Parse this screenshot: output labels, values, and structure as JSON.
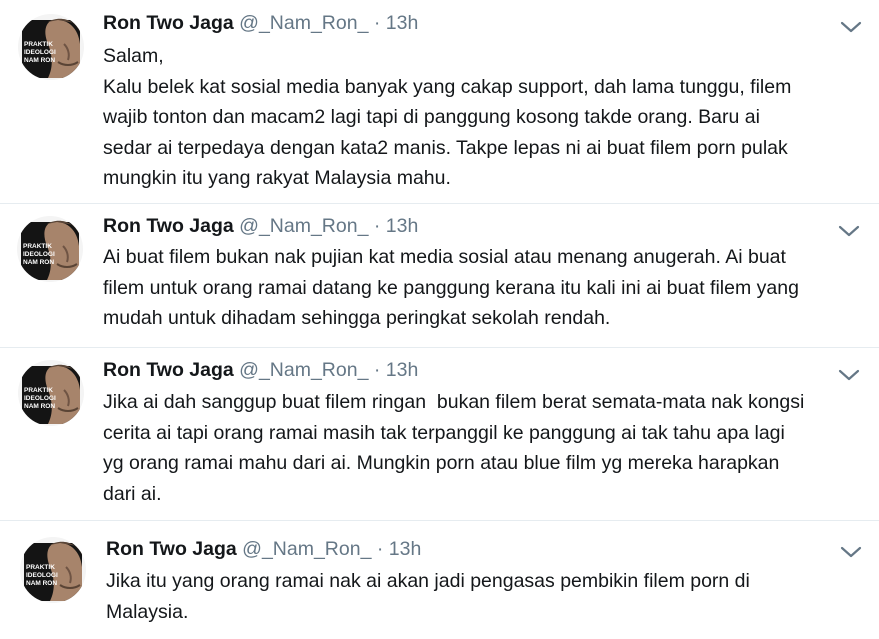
{
  "tweets": [
    {
      "author_name": "Ron Two Jaga",
      "handle": "@_Nam_Ron_",
      "separator": "·",
      "time": "13h",
      "text": "Salam,\nKalu belek kat sosial media banyak yang cakap support, dah lama tunggu, filem\nwajib tonton dan macam2 lagi tapi di panggung kosong takde orang. Baru ai\nsedar ai terpedaya dengan kata2 manis. Takpe lepas ni ai buat filem porn pulak\nmungkin itu yang rakyat Malaysia mahu."
    },
    {
      "author_name": "Ron Two Jaga",
      "handle": "@_Nam_Ron_",
      "separator": "·",
      "time": "13h",
      "text": "Ai buat filem bukan nak pujian kat media sosial atau menang anugerah. Ai buat\nfilem untuk orang ramai datang ke panggung kerana itu kali ini ai buat filem yang\nmudah untuk dihadam sehingga peringkat sekolah rendah."
    },
    {
      "author_name": "Ron Two Jaga",
      "handle": "@_Nam_Ron_",
      "separator": "·",
      "time": "13h",
      "text": "Jika ai dah sanggup buat filem ringan  bukan filem berat semata-mata nak kongsi\ncerita ai tapi orang ramai masih tak terpanggil ke panggung ai tak tahu apa lagi\nyg orang ramai mahu dari ai. Mungkin porn atau blue film yg mereka harapkan\ndari ai."
    },
    {
      "author_name": "Ron Two Jaga",
      "handle": "@_Nam_Ron_",
      "separator": "·",
      "time": "13h",
      "text": "Jika itu yang orang ramai nak ai akan jadi pengasas pembikin filem porn di\nMalaysia."
    }
  ],
  "avatar": {
    "book_title_lines": [
      "PRAKTIK",
      "IDEOLOGI",
      "NAM RON"
    ]
  },
  "icons": {
    "menu": "chevron-down-icon"
  },
  "colors": {
    "text": "#14171a",
    "secondary": "#657786",
    "divider": "#e6ecf0"
  }
}
